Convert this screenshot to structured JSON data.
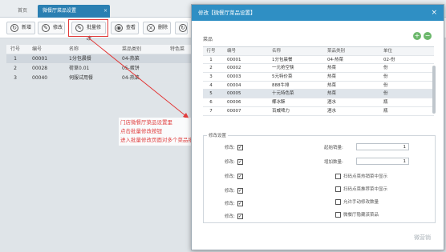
{
  "tabs": {
    "home": "首页",
    "active": "微餐厅菜品设置"
  },
  "toolbar": {
    "new": "新增",
    "edit": "修改",
    "batch_edit": "批量修改",
    "view": "查看",
    "delete": "删除",
    "refresh": "刷新"
  },
  "left_table": {
    "headers": [
      "行号",
      "编号",
      "名称",
      "菜品类别",
      "特色菜"
    ],
    "rows": [
      [
        "1",
        "00001",
        "1分包晨餐",
        "04-热菜",
        ""
      ],
      [
        "2",
        "00028",
        "荷草0.01",
        "05-蛋饼",
        ""
      ],
      [
        "3",
        "00040",
        "伺服试用餐",
        "04-热菜",
        ""
      ]
    ]
  },
  "annotation": {
    "line1": "门店微餐厅菜品设置里",
    "line2": "点击批量修改按钮",
    "line3": "进入批量修改页面对多个菜品批量修改"
  },
  "modal": {
    "title": "修改【微餐厅菜品设置】",
    "group_label": "菜品",
    "table": {
      "headers": [
        "行号",
        "编号",
        "名称",
        "菜品类别",
        "单位"
      ],
      "rows": [
        [
          "1",
          "00001",
          "1分包晨餐",
          "04-热菜",
          "02-份"
        ],
        [
          "2",
          "00002",
          "一元抢空筷",
          "热菜",
          "份"
        ],
        [
          "3",
          "00003",
          "5元特价菜",
          "热菜",
          "份"
        ],
        [
          "4",
          "00004",
          "888牛排",
          "热菜",
          "份"
        ],
        [
          "5",
          "00005",
          "十元特色菜",
          "热菜",
          "份"
        ],
        [
          "6",
          "00006",
          "椰冰酥",
          "酒水",
          "瓶"
        ],
        [
          "7",
          "00007",
          "百威啤力",
          "酒水",
          "瓶"
        ]
      ]
    },
    "settings": {
      "title": "修改设置",
      "left_labels": [
        "修改:",
        "修改:",
        "修改:",
        "修改:",
        "修改:",
        "修改:"
      ],
      "min_qty_label": "起始销量:",
      "min_qty_value": "1",
      "add_qty_label": "增加数量:",
      "add_qty_value": "1",
      "options": [
        "扫码点菜热销菜中显示",
        "扫码点菜推荐菜中显示",
        "允许手动修改数量",
        "微餐厅隐藏该菜品"
      ]
    }
  },
  "watermark": "微营销"
}
